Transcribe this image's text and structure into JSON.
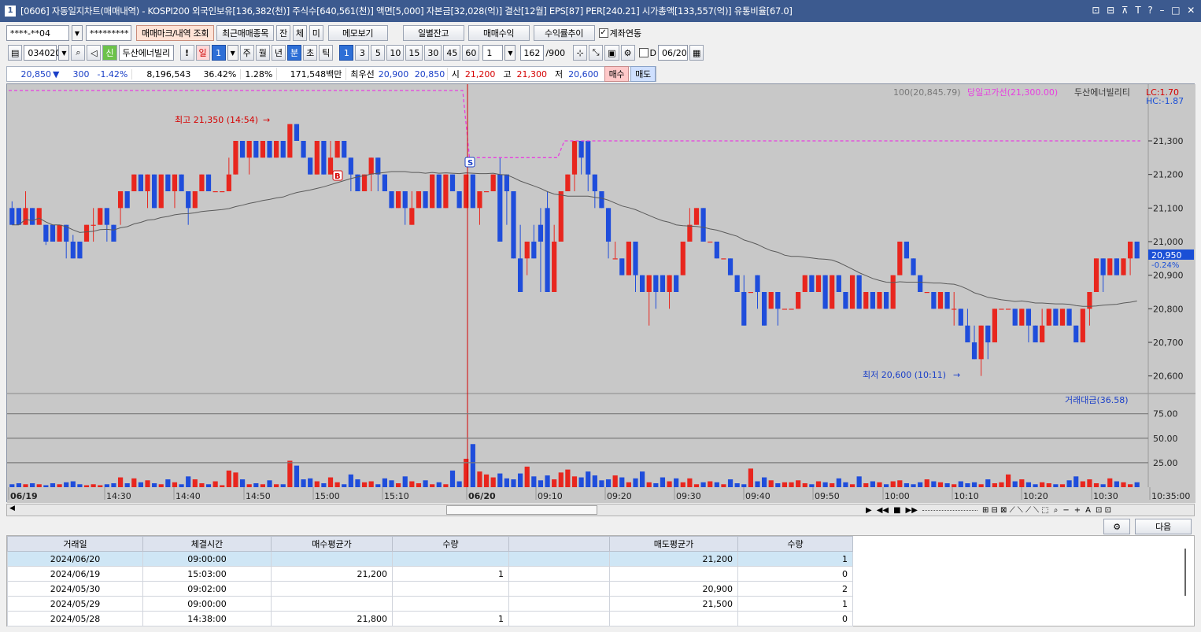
{
  "window": {
    "icon_num": "1",
    "title": "[0606] 자동일지차트(매매내역) - KOSPI200 외국인보유[136,382(천)] 주식수[640,561(천)] 액면[5,000] 자본금[32,028(억)] 결산[12월] EPS[87] PER[240.21] 시가총액[133,557(억)] 유통비율[67.0]",
    "controls": [
      "⊡",
      "⊟",
      "⊼",
      "T",
      "?",
      "–",
      "□",
      "✕"
    ]
  },
  "toolbar1": {
    "account": "****-**04",
    "password": "*********",
    "btn_markview": "매매마크/내역 조회",
    "btn_recent": "최근매매종목",
    "btn_jan": "잔",
    "btn_che": "체",
    "btn_mi": "미",
    "btn_memo": "메모보기",
    "btn_daily": "일별잔고",
    "btn_profit": "매매수익",
    "btn_ratio": "수익률추이",
    "chk_link": "계좌연동"
  },
  "toolbar2": {
    "code": "034020",
    "new_badge": "신",
    "stock_name": "두산에너빌리",
    "bang": "!",
    "day_sel": "일",
    "num_sel": "1",
    "periods": [
      "주",
      "월",
      "년"
    ],
    "min_sel": "분",
    "periods2": [
      "초",
      "틱"
    ],
    "intervals": [
      "1",
      "3",
      "5",
      "10",
      "15",
      "30",
      "45",
      "60"
    ],
    "interval_input": "1",
    "count": "162",
    "count_total": "/900",
    "d_label": "D",
    "date": "06/20"
  },
  "infobar": {
    "price": "20,850",
    "arrow": "▼",
    "change": "300",
    "rate": "-1.42%",
    "volume": "8,196,543",
    "vol_rate": "36.42%",
    "turnover": "1.28%",
    "amount": "171,548백만",
    "pref_label": "최우선",
    "best_bid": "20,900",
    "best_ask": "20,850",
    "open_label": "시",
    "open": "21,200",
    "high_label": "고",
    "high": "21,300",
    "low_label": "저",
    "low": "20,600",
    "buy_btn": "매수",
    "sell_btn": "매도"
  },
  "chart_data": {
    "type": "candlestick",
    "legend_ma": "100(20,845.79)",
    "legend_line": "당일고가선(21,300.00)",
    "legend_name": "두산에너빌리티",
    "lc": "LC:1.70",
    "hc": "HC:-1.87",
    "high_annot": "최고 21,350 (14:54)",
    "low_annot": "최저 20,600 (10:11)",
    "marker_b": "B",
    "marker_s": "S",
    "current_price": "20,950",
    "current_rate": "-0.24%",
    "y_ticks": [
      "21,300",
      "21,200",
      "21,100",
      "21,000",
      "20,900",
      "20,800",
      "20,700",
      "20,600"
    ],
    "y_values": [
      21300,
      21200,
      21100,
      21000,
      20900,
      20800,
      20700,
      20600
    ],
    "ylim": [
      20550,
      21450
    ],
    "volume_label": "거래대금(36.58)",
    "vol_ticks": [
      "75.00",
      "50.00",
      "25.00"
    ],
    "vol_values": [
      75,
      50,
      25
    ],
    "x_ticks": [
      "06/19",
      "14:30",
      "14:40",
      "14:50",
      "15:00",
      "15:10",
      "06/20",
      "09:10",
      "09:20",
      "09:30",
      "09:40",
      "09:50",
      "10:00",
      "10:10",
      "10:20",
      "10:30",
      "10:35:00"
    ],
    "candles": [
      [
        21100,
        21050,
        21120,
        21050
      ],
      [
        21100,
        21050,
        21100,
        21050
      ],
      [
        21050,
        21100,
        21150,
        21050
      ],
      [
        21100,
        21050,
        21100,
        21050
      ],
      [
        21050,
        21100,
        21100,
        21050
      ],
      [
        21050,
        21000,
        21050,
        20990
      ],
      [
        21050,
        21000,
        21050,
        21000
      ],
      [
        21000,
        21050,
        21050,
        21000
      ],
      [
        21050,
        21000,
        21050,
        20950
      ],
      [
        21000,
        20950,
        21020,
        20950
      ],
      [
        21000,
        20950,
        21000,
        20950
      ],
      [
        21000,
        21050,
        21050,
        21000
      ],
      [
        21050,
        21050,
        21100,
        21000
      ],
      [
        21050,
        21100,
        21100,
        21050
      ],
      [
        21100,
        21050,
        21100,
        21000
      ],
      [
        21050,
        21000,
        21050,
        21000
      ],
      [
        21100,
        21150,
        21150,
        21050
      ],
      [
        21150,
        21100,
        21150,
        21100
      ],
      [
        21150,
        21200,
        21200,
        21150
      ],
      [
        21200,
        21150,
        21200,
        21150
      ],
      [
        21150,
        21200,
        21200,
        21100
      ],
      [
        21200,
        21100,
        21200,
        21100
      ],
      [
        21100,
        21200,
        21200,
        21100
      ],
      [
        21200,
        21150,
        21200,
        21150
      ],
      [
        21150,
        21200,
        21200,
        21100
      ],
      [
        21200,
        21150,
        21200,
        21150
      ],
      [
        21150,
        21100,
        21150,
        21050
      ],
      [
        21100,
        21150,
        21150,
        21100
      ],
      [
        21150,
        21200,
        21200,
        21150
      ],
      [
        21200,
        21150,
        21200,
        21150
      ],
      [
        21150,
        21150,
        21150,
        21150
      ],
      [
        21150,
        21150,
        21150,
        21150
      ],
      [
        21150,
        21200,
        21250,
        21150
      ],
      [
        21200,
        21300,
        21300,
        21200
      ],
      [
        21300,
        21250,
        21300,
        21250
      ],
      [
        21250,
        21300,
        21300,
        21200
      ],
      [
        21300,
        21250,
        21300,
        21250
      ],
      [
        21250,
        21300,
        21300,
        21250
      ],
      [
        21300,
        21250,
        21300,
        21250
      ],
      [
        21250,
        21300,
        21300,
        21250
      ],
      [
        21300,
        21250,
        21300,
        21250
      ],
      [
        21250,
        21350,
        21350,
        21250
      ],
      [
        21350,
        21300,
        21350,
        21300
      ],
      [
        21300,
        21250,
        21300,
        21250
      ],
      [
        21250,
        21200,
        21250,
        21200
      ],
      [
        21200,
        21300,
        21300,
        21200
      ],
      [
        21300,
        21200,
        21300,
        21200
      ],
      [
        21200,
        21250,
        21300,
        21200
      ],
      [
        21250,
        21300,
        21300,
        21250
      ],
      [
        21300,
        21250,
        21300,
        21250
      ],
      [
        21250,
        21200,
        21250,
        21150
      ],
      [
        21200,
        21150,
        21200,
        21150
      ],
      [
        21150,
        21200,
        21200,
        21150
      ],
      [
        21200,
        21250,
        21250,
        21150
      ],
      [
        21250,
        21200,
        21250,
        21150
      ],
      [
        21200,
        21150,
        21200,
        21150
      ],
      [
        21150,
        21100,
        21150,
        21100
      ],
      [
        21100,
        21150,
        21150,
        21100
      ],
      [
        21150,
        21100,
        21150,
        21050
      ],
      [
        21050,
        21100,
        21150,
        21050
      ],
      [
        21100,
        21150,
        21150,
        21100
      ],
      [
        21150,
        21100,
        21150,
        21100
      ],
      [
        21100,
        21200,
        21200,
        21100
      ],
      [
        21200,
        21100,
        21200,
        21100
      ],
      [
        21100,
        21200,
        21200,
        21100
      ],
      [
        21200,
        21150,
        21200,
        21150
      ],
      [
        21150,
        21100,
        21150,
        21100
      ],
      [
        21100,
        21200,
        21200,
        21100
      ],
      [
        21200,
        21100,
        21200,
        21100
      ],
      [
        21100,
        21150,
        21150,
        21050
      ],
      [
        21150,
        21150,
        21150,
        21150
      ],
      [
        21150,
        21200,
        21200,
        21150
      ],
      [
        21200,
        21000,
        21250,
        21000
      ],
      [
        21200,
        21150,
        21200,
        21050
      ],
      [
        21150,
        20950,
        21150,
        20950
      ],
      [
        20950,
        20850,
        21050,
        20850
      ],
      [
        20950,
        21000,
        21000,
        20900
      ],
      [
        21000,
        20950,
        21050,
        20950
      ],
      [
        21050,
        21000,
        21100,
        20850
      ],
      [
        21100,
        20850,
        21150,
        20850
      ],
      [
        20850,
        21000,
        21050,
        20850
      ],
      [
        21000,
        21150,
        21150,
        21000
      ],
      [
        21150,
        21200,
        21200,
        21150
      ],
      [
        21200,
        21300,
        21300,
        21150
      ],
      [
        21300,
        21250,
        21300,
        21200
      ],
      [
        21300,
        21200,
        21300,
        21150
      ],
      [
        21200,
        21150,
        21200,
        21100
      ],
      [
        21150,
        21100,
        21150,
        21100
      ],
      [
        21100,
        21000,
        21100,
        20950
      ],
      [
        20950,
        20950,
        21000,
        20950
      ],
      [
        20950,
        20900,
        20950,
        20900
      ],
      [
        20900,
        21000,
        21000,
        20900
      ],
      [
        21000,
        20900,
        21000,
        20850
      ],
      [
        20900,
        20850,
        20900,
        20850
      ],
      [
        20850,
        20900,
        20900,
        20750
      ],
      [
        20900,
        20850,
        20900,
        20800
      ],
      [
        20900,
        20850,
        20900,
        20850
      ],
      [
        20850,
        20900,
        20900,
        20800
      ],
      [
        20900,
        20850,
        20900,
        20850
      ],
      [
        20900,
        21000,
        21000,
        20900
      ],
      [
        21000,
        21050,
        21100,
        21000
      ],
      [
        21050,
        21100,
        21100,
        21050
      ],
      [
        21100,
        21000,
        21100,
        21000
      ],
      [
        21000,
        21000,
        21000,
        21000
      ],
      [
        21000,
        20950,
        21000,
        20950
      ],
      [
        20950,
        20950,
        20950,
        20950
      ],
      [
        20950,
        20900,
        20950,
        20900
      ],
      [
        20900,
        20850,
        20900,
        20850
      ],
      [
        20850,
        20750,
        20900,
        20750
      ],
      [
        20850,
        20850,
        20850,
        20850
      ],
      [
        20900,
        20850,
        20900,
        20800
      ],
      [
        20850,
        20750,
        20850,
        20750
      ],
      [
        20800,
        20850,
        20850,
        20800
      ],
      [
        20850,
        20800,
        20850,
        20750
      ],
      [
        20800,
        20800,
        20800,
        20800
      ],
      [
        20800,
        20800,
        20800,
        20800
      ],
      [
        20800,
        20850,
        20850,
        20800
      ],
      [
        20850,
        20900,
        20900,
        20850
      ],
      [
        20900,
        20850,
        20900,
        20850
      ],
      [
        20850,
        20900,
        20900,
        20850
      ],
      [
        20900,
        20800,
        20900,
        20800
      ],
      [
        20800,
        20900,
        20900,
        20800
      ],
      [
        20900,
        20850,
        20900,
        20850
      ],
      [
        20850,
        20800,
        20850,
        20800
      ],
      [
        20800,
        20900,
        20900,
        20800
      ],
      [
        20900,
        20800,
        20900,
        20800
      ],
      [
        20800,
        20850,
        20850,
        20800
      ],
      [
        20850,
        20800,
        20850,
        20800
      ],
      [
        20800,
        20850,
        20850,
        20800
      ],
      [
        20850,
        20800,
        20850,
        20800
      ],
      [
        20800,
        20900,
        20900,
        20800
      ],
      [
        20900,
        21000,
        21000,
        20900
      ],
      [
        21000,
        20950,
        21000,
        20950
      ],
      [
        20950,
        20900,
        20950,
        20900
      ],
      [
        20900,
        20850,
        20900,
        20850
      ],
      [
        20850,
        20850,
        20850,
        20850
      ],
      [
        20850,
        20800,
        20850,
        20800
      ],
      [
        20800,
        20850,
        20850,
        20800
      ],
      [
        20850,
        20800,
        20850,
        20800
      ],
      [
        20800,
        20800,
        20850,
        20750
      ],
      [
        20800,
        20750,
        20800,
        20750
      ],
      [
        20750,
        20700,
        20800,
        20700
      ],
      [
        20700,
        20650,
        20750,
        20650
      ],
      [
        20650,
        20750,
        20750,
        20600
      ],
      [
        20750,
        20700,
        20750,
        20650
      ],
      [
        20700,
        20800,
        20800,
        20700
      ],
      [
        20800,
        20800,
        20800,
        20800
      ],
      [
        20800,
        20800,
        20800,
        20800
      ],
      [
        20800,
        20750,
        20800,
        20750
      ],
      [
        20750,
        20800,
        20800,
        20750
      ],
      [
        20800,
        20750,
        20800,
        20700
      ],
      [
        20750,
        20700,
        20750,
        20700
      ],
      [
        20700,
        20750,
        20800,
        20700
      ],
      [
        20750,
        20800,
        20800,
        20750
      ],
      [
        20800,
        20750,
        20800,
        20750
      ],
      [
        20750,
        20800,
        20800,
        20750
      ],
      [
        20800,
        20750,
        20800,
        20750
      ],
      [
        20750,
        20700,
        20750,
        20700
      ],
      [
        20700,
        20800,
        20800,
        20700
      ],
      [
        20800,
        20850,
        20850,
        20750
      ],
      [
        20850,
        20950,
        20950,
        20850
      ],
      [
        20950,
        20900,
        20950,
        20850
      ],
      [
        20900,
        20950,
        20950,
        20900
      ],
      [
        20950,
        20900,
        20950,
        20900
      ],
      [
        20900,
        20950,
        20950,
        20900
      ],
      [
        20950,
        21000,
        21000,
        20900
      ],
      [
        21000,
        20950,
        21000,
        20950
      ]
    ],
    "volumes": [
      3,
      4,
      3,
      4,
      3,
      2,
      4,
      3,
      5,
      6,
      3,
      2,
      3,
      2,
      3,
      4,
      10,
      4,
      9,
      5,
      7,
      4,
      3,
      8,
      5,
      3,
      11,
      8,
      4,
      3,
      6,
      2,
      17,
      15,
      8,
      3,
      4,
      3,
      7,
      3,
      3,
      27,
      22,
      8,
      9,
      6,
      4,
      10,
      5,
      3,
      13,
      8,
      5,
      6,
      3,
      9,
      7,
      4,
      11,
      6,
      4,
      7,
      3,
      5,
      3,
      17,
      6,
      29,
      44,
      16,
      13,
      10,
      14,
      9,
      8,
      14,
      21,
      11,
      7,
      12,
      8,
      15,
      18,
      11,
      10,
      16,
      12,
      7,
      8,
      12,
      10,
      5,
      9,
      16,
      5,
      4,
      10,
      6,
      9,
      5,
      9,
      3,
      5,
      6,
      5,
      3,
      8,
      4,
      3,
      19,
      6,
      10,
      7,
      4,
      5,
      5,
      7,
      4,
      3,
      6,
      5,
      4,
      9,
      5,
      3,
      11,
      4,
      6,
      5,
      3,
      6,
      7,
      4,
      3,
      5,
      8,
      6,
      5,
      4,
      3,
      6,
      4,
      5,
      3,
      8,
      4,
      5,
      13,
      6,
      8,
      5,
      3,
      5,
      4,
      3,
      3,
      7,
      11,
      6,
      8,
      4,
      3,
      9,
      6,
      5,
      3,
      5,
      13,
      16,
      14,
      16,
      18,
      35,
      6,
      4,
      3,
      3
    ]
  },
  "table": {
    "headers": [
      "거래일",
      "체결시간",
      "매수평균가",
      "수량",
      "",
      "매도평균가",
      "수량"
    ],
    "rows": [
      [
        "2024/06/20",
        "09:00:00",
        "",
        "",
        "",
        "21,200",
        "1"
      ],
      [
        "2024/06/19",
        "15:03:00",
        "21,200",
        "1",
        "",
        "",
        "0"
      ],
      [
        "2024/05/30",
        "09:02:00",
        "",
        "",
        "",
        "20,900",
        "2"
      ],
      [
        "2024/05/29",
        "09:00:00",
        "",
        "",
        "",
        "21,500",
        "1"
      ],
      [
        "2024/05/28",
        "14:38:00",
        "21,800",
        "1",
        "",
        "",
        "0"
      ]
    ],
    "next_btn": "다음"
  }
}
